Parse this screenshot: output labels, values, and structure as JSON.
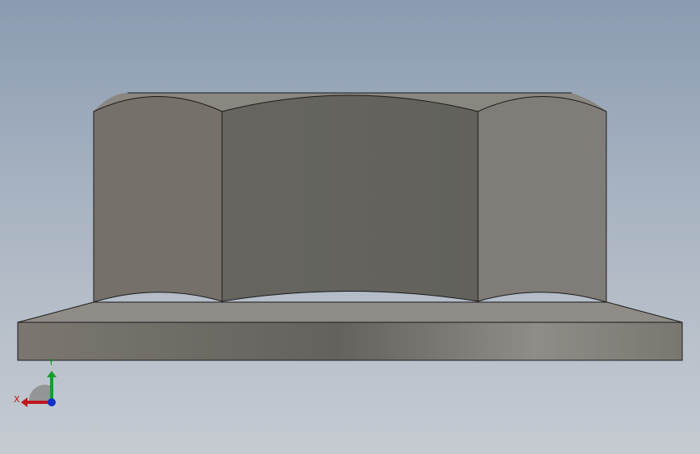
{
  "viewport": {
    "background_top": "#8a9bb1",
    "background_bottom": "#c6cbd1"
  },
  "model": {
    "part": "flange-hex-nut",
    "view": "front",
    "colors": {
      "side_face_left": "#757069",
      "center_face": "#64635e",
      "side_face_right": "#807c77",
      "flange_top": "#8f8b86",
      "flange_front_dark": "#64625d",
      "flange_front_light": "#908c87",
      "edge": "#1a1a1a"
    }
  },
  "triad": {
    "x_label": "X",
    "y_label": "Y",
    "x_color": "#c0151c",
    "y_color": "#1a9a2c",
    "z_color": "#1030c8",
    "icon": "coordinate-triad-icon"
  }
}
